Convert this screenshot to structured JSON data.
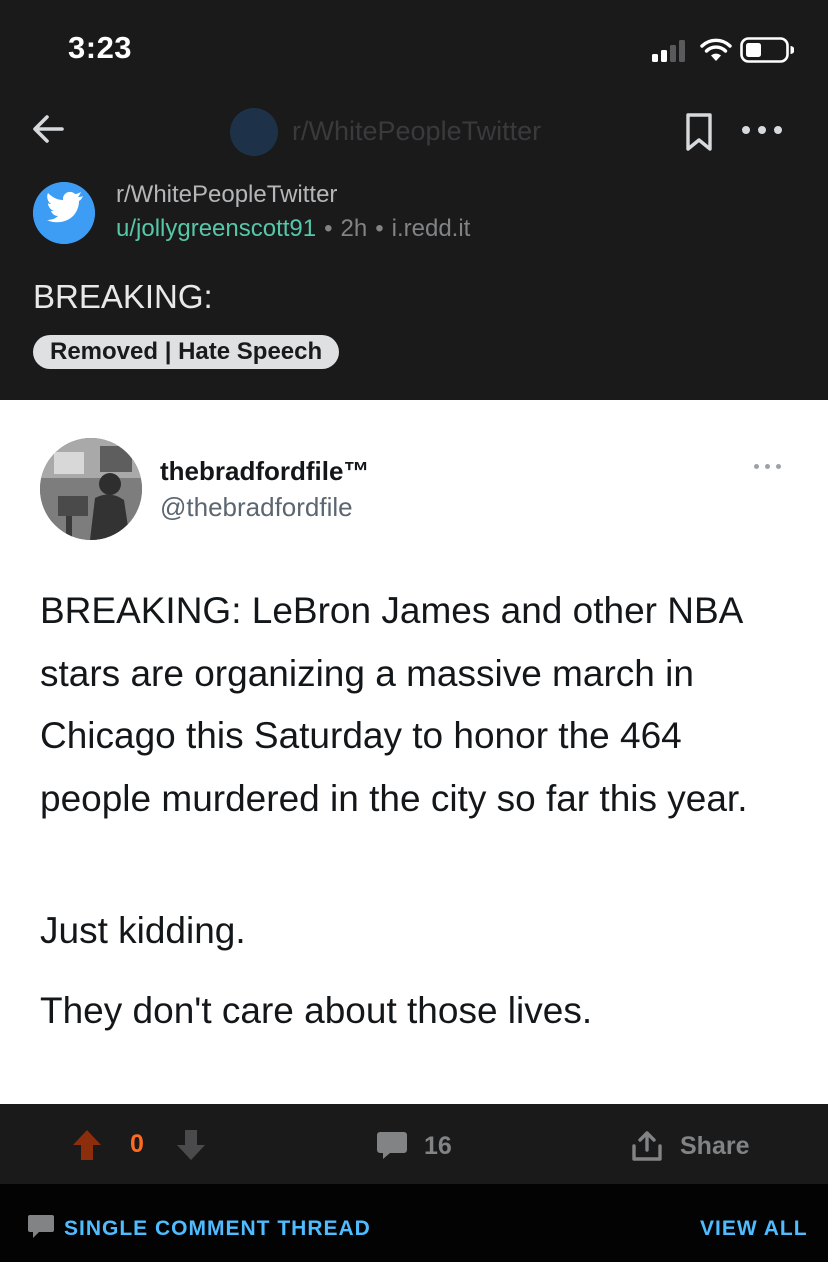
{
  "status_bar": {
    "time": "3:23"
  },
  "header": {
    "title": "r/WhitePeopleTwitter"
  },
  "post": {
    "subreddit": "r/WhitePeopleTwitter",
    "author": "u/jollygreenscott91",
    "age": "2h",
    "domain": "i.redd.it",
    "separator": "•",
    "title": "BREAKING:",
    "flair": "Removed | Hate Speech"
  },
  "tweet": {
    "display_name": "thebradfordfile™",
    "handle": "@thebradfordfile",
    "body": "BREAKING: LeBron James and other NBA stars are organizing a massive march in Chicago this Saturday to honor the 464 people murdered in the city so far this year.",
    "line2": "Just kidding.",
    "line3": "They don't care about those lives."
  },
  "actions": {
    "vote_count": "0",
    "comment_count": "16",
    "share_label": "Share"
  },
  "bottom_bar": {
    "thread_label": "SINGLE COMMENT THREAD",
    "view_all_label": "VIEW ALL"
  },
  "colors": {
    "background": "#1a1a1b",
    "author": "#56c7a8",
    "upvote": "#ff6a1f",
    "link_blue": "#4fbcff",
    "subreddit_icon": "#3d9df5"
  },
  "icons": {
    "back": "arrow-left-icon",
    "bookmark": "bookmark-icon",
    "more": "more-horizontal-icon",
    "upvote": "upvote-arrow-icon",
    "downvote": "downvote-arrow-icon",
    "comment": "comment-bubble-icon",
    "share": "share-icon",
    "thread": "chat-bubble-icon"
  }
}
